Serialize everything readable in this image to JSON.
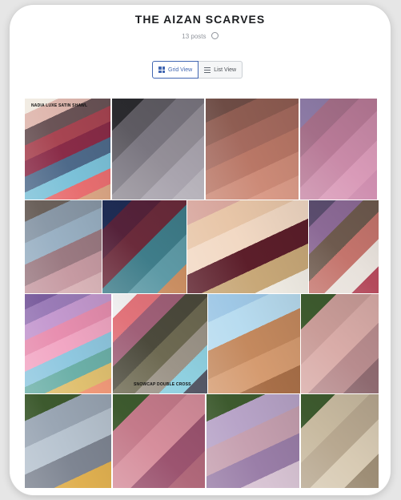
{
  "page": {
    "title": "THE AIZAN SCARVES",
    "meta": "13 posts"
  },
  "view_toggle": {
    "grid_label": "Grid View",
    "list_label": "List View"
  },
  "photos": [
    {
      "name": "photo-nadia-luxe-satin",
      "caption": "NADIA LUXE SATIN SHAWL",
      "colors": [
        "#f1ebe2",
        "#e0b9b0",
        "#6b5457",
        "#a84552",
        "#8a2c48",
        "#4e6a8a",
        "#7bc1d8",
        "#e86e70",
        "#d9a584"
      ]
    },
    {
      "name": "photo-dark-grey-shades",
      "caption": "",
      "colors": [
        "#2a2a2e",
        "#5e5b62",
        "#7a7680",
        "#948f98",
        "#a9a4ae",
        "#b8b4bc"
      ]
    },
    {
      "name": "photo-brown-peach-shades",
      "caption": "",
      "colors": [
        "#6e4c45",
        "#8f5d52",
        "#a56a5e",
        "#b97766",
        "#cc8a77",
        "#d99a87"
      ]
    },
    {
      "name": "photo-mauve-pink-shades",
      "caption": "",
      "colors": [
        "#8c7aa5",
        "#a46e88",
        "#b87a97",
        "#c98aa8",
        "#d99ab8",
        "#cf8fb0"
      ]
    },
    {
      "name": "photo-grey-blue-pink-shades",
      "caption": "",
      "colors": [
        "#6b615b",
        "#8a99a8",
        "#9ab1c4",
        "#9b7a82",
        "#c69aa2",
        "#d9b4b8"
      ]
    },
    {
      "name": "photo-navy-maroon-teal",
      "caption": "",
      "colors": [
        "#1e2c54",
        "#55223a",
        "#6b2b3b",
        "#3f7d8a",
        "#5e9aa6",
        "#c98e62"
      ]
    },
    {
      "name": "photo-model-hijab",
      "caption": "",
      "colors": [
        "#d8a79e",
        "#e8c6a8",
        "#f2d9c4",
        "#5c1e2a",
        "#c8a878",
        "#f0ece4"
      ]
    },
    {
      "name": "photo-assorted-labels",
      "caption": "",
      "colors": [
        "#5b4d6e",
        "#8c6a96",
        "#6e5a4e",
        "#c4746c",
        "#e8e2dc",
        "#b44a5c"
      ]
    },
    {
      "name": "photo-rainbow-stack",
      "caption": "",
      "colors": [
        "#7b5e9e",
        "#9b7cb8",
        "#c59ad0",
        "#e88fb0",
        "#f2a7c4",
        "#8fc8e0",
        "#6cb0a8",
        "#e0c070",
        "#f29a7a"
      ]
    },
    {
      "name": "photo-snowcap-double-cross",
      "caption": "SNOWCAP DOUBLE CROSS",
      "colors": [
        "#efefef",
        "#e2737a",
        "#a06078",
        "#4c4a3c",
        "#6e6a52",
        "#9c9488",
        "#8fd0e0",
        "#555866"
      ]
    },
    {
      "name": "photo-snowcap-closeup",
      "caption": "",
      "colors": [
        "#9fc8e6",
        "#b8dcf0",
        "#c4895e",
        "#d59b70",
        "#a86f48"
      ]
    },
    {
      "name": "photo-dusty-pink-drape",
      "caption": "",
      "colors": [
        "#3d5a2e",
        "#c99c98",
        "#d9aca8",
        "#b88c8e",
        "#8e6a70"
      ]
    },
    {
      "name": "photo-grey-blue-yellow-drape",
      "caption": "",
      "colors": [
        "#3d5a2e",
        "#9aa6b4",
        "#b8c4d0",
        "#7e8592",
        "#e0b050"
      ]
    },
    {
      "name": "photo-rose-drape",
      "caption": "",
      "colors": [
        "#3d5a2e",
        "#c47a8a",
        "#d68e9c",
        "#9c5470",
        "#b0687a"
      ]
    },
    {
      "name": "photo-lilac-drape",
      "caption": "",
      "colors": [
        "#3d5a2e",
        "#b8a4c8",
        "#c6a0b0",
        "#9a7ea8",
        "#d8c4d4"
      ]
    },
    {
      "name": "photo-beige-drape",
      "caption": "",
      "colors": [
        "#3d5a2e",
        "#c8baa0",
        "#b8a890",
        "#d8cbb4",
        "#9e8e76"
      ]
    }
  ]
}
